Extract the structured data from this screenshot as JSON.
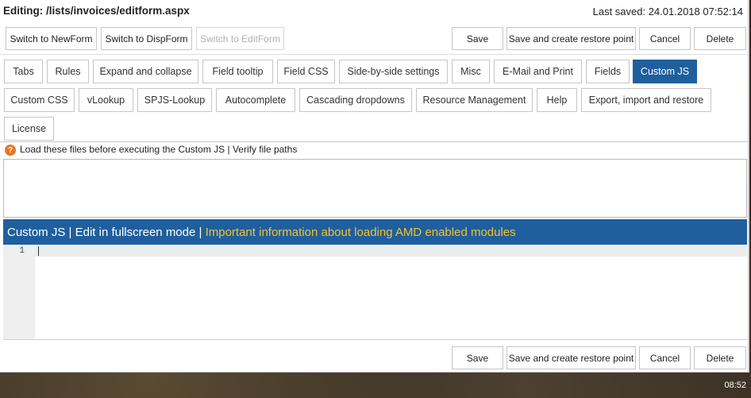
{
  "header": {
    "editing_label": "Editing: /lists/invoices/editform.aspx",
    "last_saved": "Last saved: 24.01.2018 07:52:14"
  },
  "form_switch": {
    "new_form": "Switch to NewForm",
    "disp_form": "Switch to DispForm",
    "edit_form": "Switch to EditForm"
  },
  "actions": {
    "save": "Save",
    "save_restore": "Save and create restore point",
    "cancel": "Cancel",
    "delete": "Delete"
  },
  "tabs": [
    "Tabs",
    "Rules",
    "Expand and collapse",
    "Field tooltip",
    "Field CSS",
    "Side-by-side settings",
    "Misc",
    "E-Mail and Print",
    "Fields",
    "Custom JS",
    "Custom CSS",
    "vLookup",
    "SPJS-Lookup",
    "Autocomplete",
    "Cascading dropdowns",
    "Resource Management",
    "Help",
    "Export, import and restore",
    "License"
  ],
  "active_tab": "Custom JS",
  "load_files": {
    "help_glyph": "?",
    "label": "Load these files before executing the Custom JS | Verify file paths",
    "value": ""
  },
  "custom_js": {
    "title": "Custom JS",
    "sep1": " | ",
    "fullscreen": "Edit in fullscreen mode",
    "sep2": " | ",
    "amd_info": "Important information about loading AMD enabled modules",
    "line_numbers": [
      "1"
    ]
  },
  "taskbar": {
    "clock": "08:52"
  },
  "colors": {
    "accent": "#1f5f9e",
    "amd_link": "#f2c230",
    "help_icon": "#e87722"
  }
}
